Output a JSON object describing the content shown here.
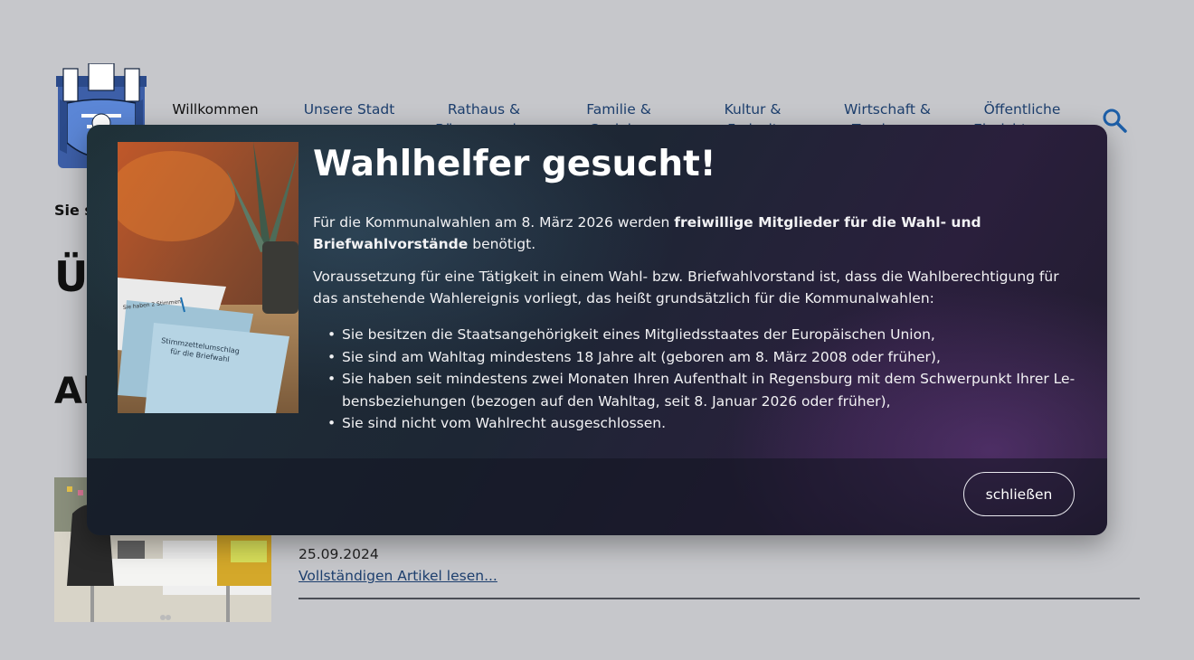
{
  "nav": {
    "items": [
      {
        "label": "Willkommen",
        "active": true
      },
      {
        "label": "Unsere Stadt",
        "active": false
      },
      {
        "label": "Rathaus & Bürgerservice",
        "active": false
      },
      {
        "label": "Familie & Soziales",
        "active": false
      },
      {
        "label": "Kultur & Freizeit",
        "active": false
      },
      {
        "label": "Wirtschaft & Tourismus",
        "active": false
      },
      {
        "label": "Öffentliche Einrichtungen",
        "active": false
      }
    ],
    "search_icon": "search-icon"
  },
  "breadcrumb": "Sie s",
  "page_title": "Ü",
  "section_title": "Al",
  "article": {
    "date": "25.09.2024",
    "link_label": "Vollständigen Artikel lesen..."
  },
  "modal": {
    "heading": "Wahlhelfer gesucht!",
    "intro_pre": "Für die Kommunalwahlen am 8. März 2026 werden ",
    "intro_bold": "freiwillige Mitglieder für die Wahl- und Briefwahlvorstän­de",
    "intro_post": " benötigt.",
    "paragraph2": "Voraussetzung für eine Tätigkeit in einem Wahl- bzw. Briefwahlvorstand ist, dass die Wahlberechtigung für das anstehende Wahlereignis vorliegt, das heißt grundsätzlich für die Kommunalwahlen:",
    "requirements": [
      "Sie besitzen die Staatsangehörigkeit eines Mitgliedsstaates der Europäischen Union,",
      "Sie sind am Wahltag mindestens 18 Jahre alt (geboren am 8. März 2008 oder früher),",
      "Sie haben seit mindestens zwei Monaten Ihren Aufenthalt in Regensburg mit dem Schwerpunkt Ihrer Le­bensbeziehungen (bezogen auf den Wahltag, seit 8. Januar 2026 oder früher),",
      "Sie sind nicht vom Wahlrecht ausgeschlossen."
    ],
    "image_text": {
      "line1": "Stimmzettelumschlag",
      "line2": "für die Briefwahl",
      "stamp": "Sie haben 2 Stimmen"
    },
    "close_label": "schließen"
  }
}
